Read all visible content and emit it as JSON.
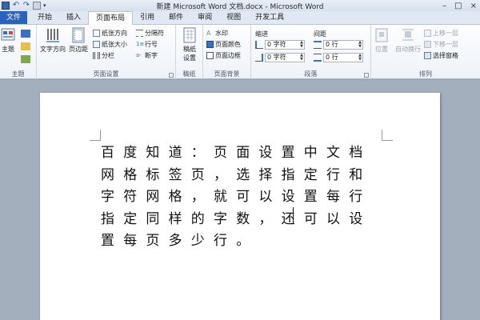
{
  "window": {
    "title": "新建 Microsoft Word 文档.docx - Microsoft Word",
    "controls": [
      "–",
      "□",
      "×"
    ]
  },
  "tabs": [
    {
      "label": "文件",
      "kind": "file"
    },
    {
      "label": "开始"
    },
    {
      "label": "插入"
    },
    {
      "label": "页面布局",
      "active": true
    },
    {
      "label": "引用"
    },
    {
      "label": "邮件"
    },
    {
      "label": "审阅"
    },
    {
      "label": "视图"
    },
    {
      "label": "开发工具"
    }
  ],
  "ribbon": {
    "theme": {
      "label": "主题",
      "button": "主题"
    },
    "page_setup": {
      "label": "页面设置",
      "text_direction": "文字方向",
      "margins": "页边距",
      "orientation": "纸张方向",
      "size": "纸张大小",
      "columns": "分栏",
      "breaks": "分隔符",
      "line_numbers": "行号",
      "hyphenation": "断字"
    },
    "manuscript": {
      "label": "稿纸",
      "button": "稿纸设置"
    },
    "page_background": {
      "label": "页面背景",
      "watermark": "水印",
      "page_color": "页面颜色",
      "page_borders": "页面边框"
    },
    "paragraph": {
      "label": "段落",
      "indent_label": "缩进",
      "spacing_label": "间距",
      "indent_left": "0 字符",
      "indent_right": "0 字符",
      "spacing_before": "0 行",
      "spacing_after": "0 行"
    },
    "arrange": {
      "label": "排列",
      "position": "位置",
      "wrap_text": "自动换行",
      "bring_forward": "上移一层",
      "send_backward": "下移一层",
      "selection_pane": "选择窗格"
    }
  },
  "document": {
    "text": "百度知道：页面设置中文档网格标签页，选择指定行和字符网格，就可以设置每行指定同样的字数，还可以设置每页多少行。"
  },
  "colors": {
    "file_tab": "#2b63b8",
    "ribbon_bg": "#fdfdfe",
    "doc_bg": "#a3afbd"
  }
}
